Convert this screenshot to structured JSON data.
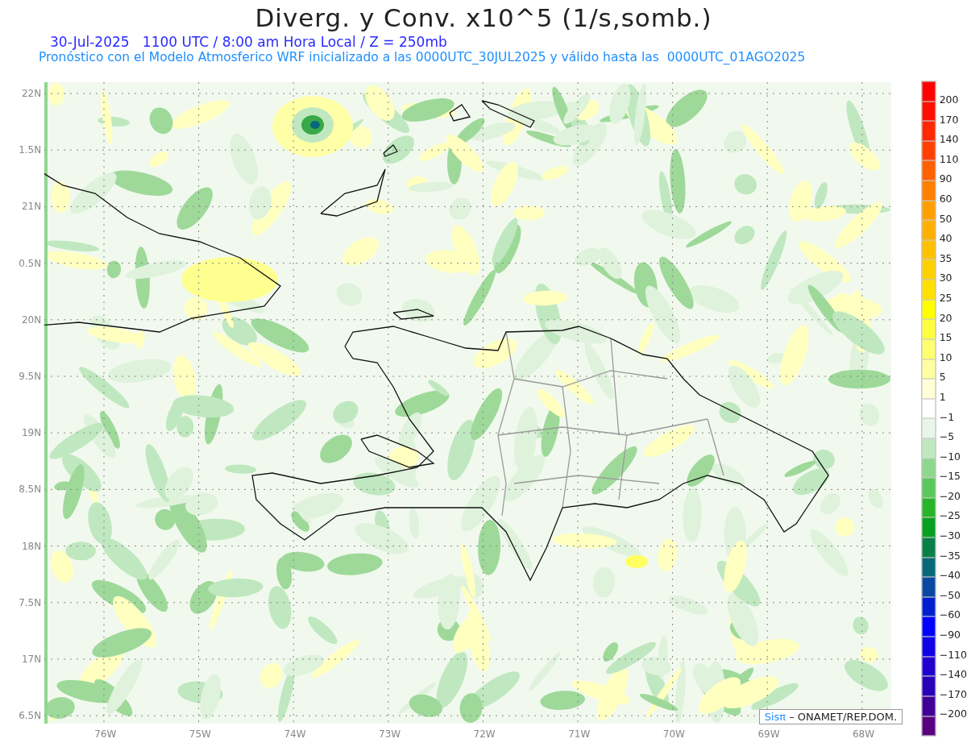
{
  "title": "Diverg. y Conv. x10^5 (1/s,somb.)",
  "subtitle": "30-Jul-2025   1100 UTC / 8:00 am Hora Local / Z = 250mb",
  "forecast_note": "Pronóstico con el Modelo Atmosferico WRF inicializado a las 0000UTC_30JUL2025 y válido hasta las  0000UTC_01AGO2025",
  "y_axis_labels": [
    "22N",
    "1.5N",
    "21N",
    "0.5N",
    "20N",
    "9.5N",
    "19N",
    "8.5N",
    "18N",
    "7.5N",
    "17N",
    "6.5N"
  ],
  "x_axis_labels": [
    "76W",
    "75W",
    "74W",
    "73W",
    "72W",
    "71W",
    "70W",
    "69W",
    "68W"
  ],
  "credit": {
    "logo": "Sisπ",
    "text": "– ONAMET/REP.DOM."
  },
  "colorbar": {
    "segments": [
      {
        "color": "#ff0000"
      },
      {
        "color": "#ff1000"
      },
      {
        "color": "#ff2800"
      },
      {
        "color": "#ff4000"
      },
      {
        "color": "#ff6000"
      },
      {
        "color": "#ff8000"
      },
      {
        "color": "#ffa000"
      },
      {
        "color": "#ffb000"
      },
      {
        "color": "#ffc000"
      },
      {
        "color": "#ffd000"
      },
      {
        "color": "#ffe000"
      },
      {
        "color": "#ffff00"
      },
      {
        "color": "#ffff40"
      },
      {
        "color": "#ffff70"
      },
      {
        "color": "#ffffa0"
      },
      {
        "color": "#ffffd8"
      },
      {
        "color": "#ffffff"
      },
      {
        "color": "#e8f5e8"
      },
      {
        "color": "#c0e8c0"
      },
      {
        "color": "#8ed88e"
      },
      {
        "color": "#5ac85a"
      },
      {
        "color": "#28b428"
      },
      {
        "color": "#08a020"
      },
      {
        "color": "#088048"
      },
      {
        "color": "#086878"
      },
      {
        "color": "#0848a0"
      },
      {
        "color": "#0020d0"
      },
      {
        "color": "#0000ff"
      },
      {
        "color": "#1000e8"
      },
      {
        "color": "#2000d0"
      },
      {
        "color": "#2800b8"
      },
      {
        "color": "#400098"
      },
      {
        "color": "#580080"
      }
    ],
    "labels": [
      "200",
      "170",
      "140",
      "110",
      "90",
      "60",
      "50",
      "40",
      "35",
      "30",
      "25",
      "20",
      "15",
      "10",
      "5",
      "1",
      "−1",
      "−5",
      "−10",
      "−15",
      "−20",
      "−25",
      "−30",
      "−35",
      "−40",
      "−50",
      "−60",
      "−90",
      "−110",
      "−140",
      "−170",
      "−200"
    ]
  }
}
